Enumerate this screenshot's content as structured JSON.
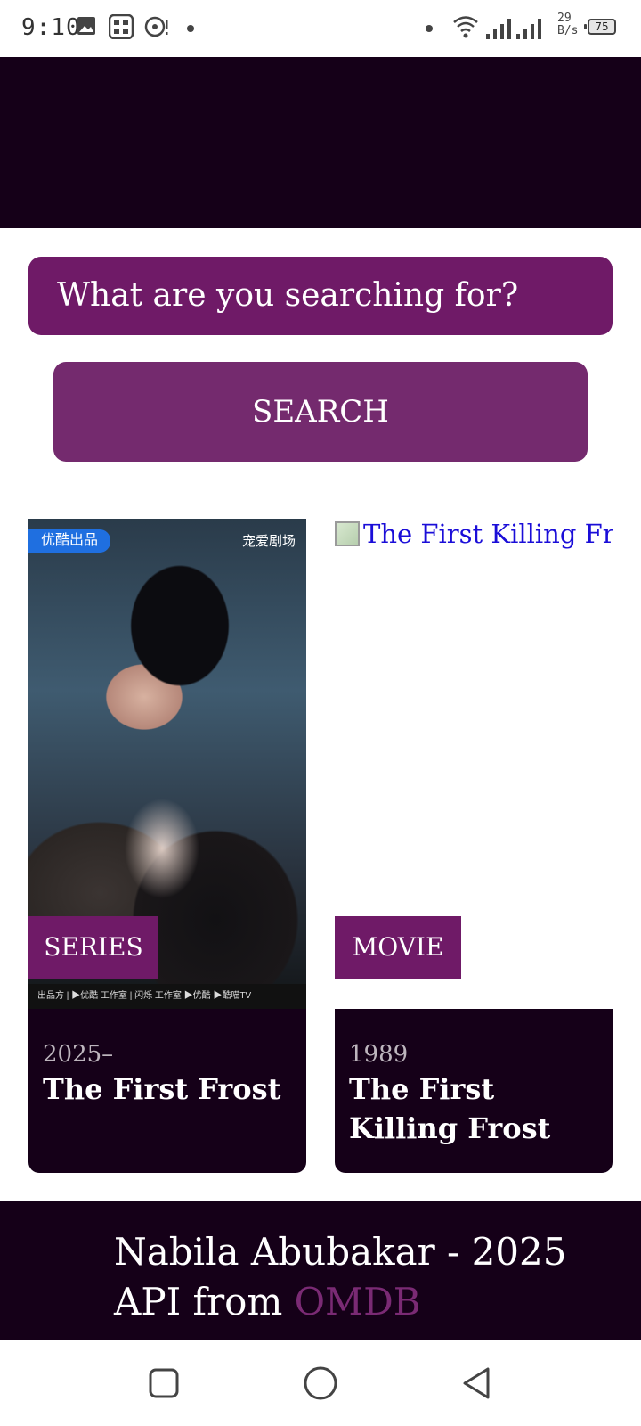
{
  "status_bar": {
    "time": "9:10",
    "net_speed_value": "29",
    "net_speed_unit": "B/s",
    "battery": "75"
  },
  "search": {
    "placeholder": "What are you searching for?",
    "button_label": "SEARCH"
  },
  "results": [
    {
      "type": "SERIES",
      "year": "2025–",
      "title": "The First Frost",
      "poster_badge_left": "优酷出品",
      "poster_badge_right": "宠爱剧场",
      "poster_credits": "出品方 | ▶优酷  工作室 | 闪烁 工作室   ▶优酷  ▶酷喵TV"
    },
    {
      "type": "MOVIE",
      "year": "1989",
      "title": "The First Killing Frost",
      "poster_alt": "The First Killing Frost"
    }
  ],
  "footer": {
    "credit": "Nabila Abubakar - 2025",
    "api_prefix": "API from ",
    "api_link": "OMDB"
  },
  "colors": {
    "dark": "#150018",
    "accent": "#6f1a67",
    "link": "#7a2a74"
  }
}
